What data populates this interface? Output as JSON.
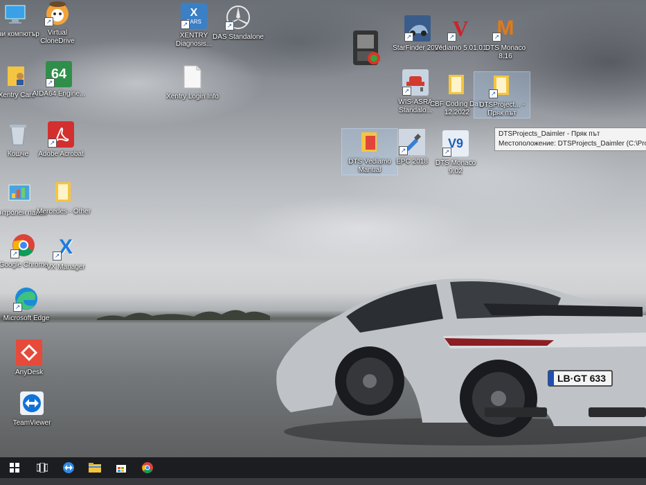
{
  "desktop": {
    "icons_left": [
      {
        "label": "Този компютър"
      },
      {
        "label": "Virtual CloneDrive"
      },
      {
        "label": "Xentry Cars"
      },
      {
        "label": "AIDA64 Engine..."
      },
      {
        "label": "Кошче"
      },
      {
        "label": "Adobe Acrobat"
      },
      {
        "label": "Контролен панел"
      },
      {
        "label": "Mercedes - Other"
      },
      {
        "label": "Google Chrome"
      },
      {
        "label": "VX Manager"
      },
      {
        "label": "Microsoft Edge"
      },
      {
        "label": "AnyDesk"
      },
      {
        "label": "TeamViewer"
      }
    ],
    "icons_top": [
      {
        "label": "XENTRY Diagnosis..."
      },
      {
        "label": "DAS Standalone"
      },
      {
        "label": "Xentry Login Info"
      }
    ],
    "icons_right": [
      {
        "label": ""
      },
      {
        "label": "StarFinder 2024"
      },
      {
        "label": "Vediamo 5.01.01"
      },
      {
        "label": "DTS Monaco 8.16"
      },
      {
        "label": "WIS-ASRA Standalo..."
      },
      {
        "label": "CBF Coding Data 12.2022"
      },
      {
        "label": "DTSProject... - Пряк път"
      },
      {
        "label": "DTS Vediamo Manual"
      },
      {
        "label": "EPC 2018"
      },
      {
        "label": "DTS Monaco 9.02"
      }
    ],
    "icon_glyph_text": {
      "aida": "64",
      "xentry_top": "X",
      "xentry_sub": "SARS",
      "vediamo": "V",
      "monaco816": "M",
      "monaco902": "V9",
      "vx": "X"
    },
    "tooltip": {
      "line1": "DTSProjects_Daimler - Пряк път",
      "line2": "Местоположение: DTSProjects_Daimler (C:\\Progra"
    },
    "car": {
      "plate": "LB·GT 633"
    }
  },
  "colors": {
    "taskbar": "#1c1d21",
    "adobe": "#d32f2f",
    "anydesk": "#e64a3a",
    "folder": "#f4c542",
    "accent_blue": "#1e7be0"
  }
}
